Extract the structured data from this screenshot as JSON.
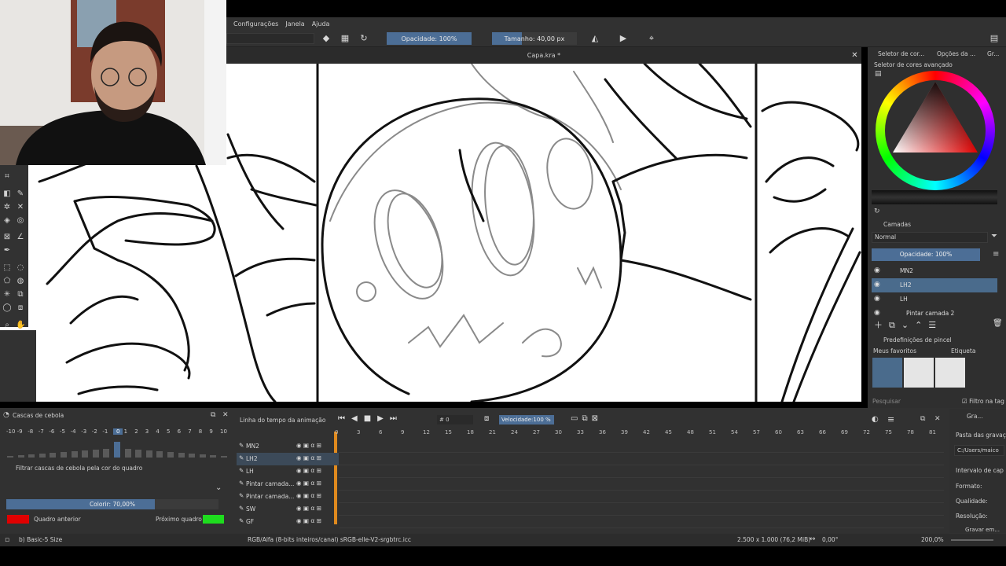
{
  "menubar": {
    "items": [
      "Configurações",
      "Janela",
      "Ajuda"
    ]
  },
  "toolbar": {
    "opacity_label": "Opacidade: 100%",
    "opacity_fraction": 1.0,
    "size_label": "Tamanho: 40,00 px",
    "size_fraction": 0.35
  },
  "document": {
    "title": "Capa.kra *"
  },
  "right_dock": {
    "tabs": [
      "Seletor de cor...",
      "Opções da ...",
      "Gr..."
    ],
    "color_selector_title": "Seletor de cores avançado",
    "layers_title": "Camadas",
    "blend_mode": "Normal",
    "layer_opacity_label": "Opacidade: 100%",
    "layers": [
      {
        "name": "MN2",
        "selected": false
      },
      {
        "name": "LH2",
        "selected": true
      },
      {
        "name": "LH",
        "selected": false
      },
      {
        "name": "Pintar camada 2",
        "selected": false
      }
    ],
    "brush_presets_title": "Predefinições de pincel",
    "favorites_label": "Meus favoritos",
    "tag_label": "Etiqueta",
    "search_placeholder": "Pesquisar",
    "filter_tag_label": "Filtro na tag"
  },
  "onion": {
    "title": "Cascas de cebola",
    "numbers": [
      "-10",
      "-9",
      "-8",
      "-7",
      "-6",
      "-5",
      "-4",
      "-3",
      "-2",
      "-1",
      "0",
      "1",
      "2",
      "3",
      "4",
      "5",
      "6",
      "7",
      "8",
      "9",
      "10"
    ],
    "filter_label": "Filtrar cascas de cebola pela cor do quadro",
    "colorize_label": "Colorir: 70,00%",
    "colorize_fraction": 0.7,
    "prev_frame_label": "Quadro anterior",
    "next_frame_label": "Próximo quadro",
    "prev_color": "#e00000",
    "next_color": "#1edc1e"
  },
  "timeline": {
    "title": "Linha do tempo da animação",
    "frame_field": "0",
    "speed_label": "Velocidade:100 %",
    "frame_numbers": [
      "0",
      "3",
      "6",
      "9",
      "12",
      "15",
      "18",
      "21",
      "24",
      "27",
      "30",
      "33",
      "36",
      "39",
      "42",
      "45",
      "48",
      "51",
      "54",
      "57",
      "60",
      "63",
      "66",
      "69",
      "72",
      "75",
      "78",
      "81"
    ],
    "rows": [
      "MN2",
      "LH2",
      "LH",
      "Pintar camada...",
      "Pintar camada...",
      "SW",
      "GF"
    ]
  },
  "render_panel": {
    "title": "Gra...",
    "folder_label": "Pasta das gravaç",
    "path_value": "C:/Users/maico",
    "interval_label": "Intervalo de cap",
    "format_label": "Formato:",
    "quality_label": "Qualidade:",
    "resolution_label": "Resolução:",
    "record_label": "Gravar em..."
  },
  "status": {
    "brush": "b) Basic-5 Size",
    "color_space": "RGB/Alfa (8-bits inteiros/canal)  sRGB-elle-V2-srgbtrc.icc",
    "dimensions": "2.500 x 1.000 (76,2 MiB)",
    "rotation": "0,00°",
    "zoom": "200,0%"
  },
  "colors": {
    "accent": "#4c6e96",
    "selection": "#4a6b8c",
    "panel": "#313131"
  }
}
